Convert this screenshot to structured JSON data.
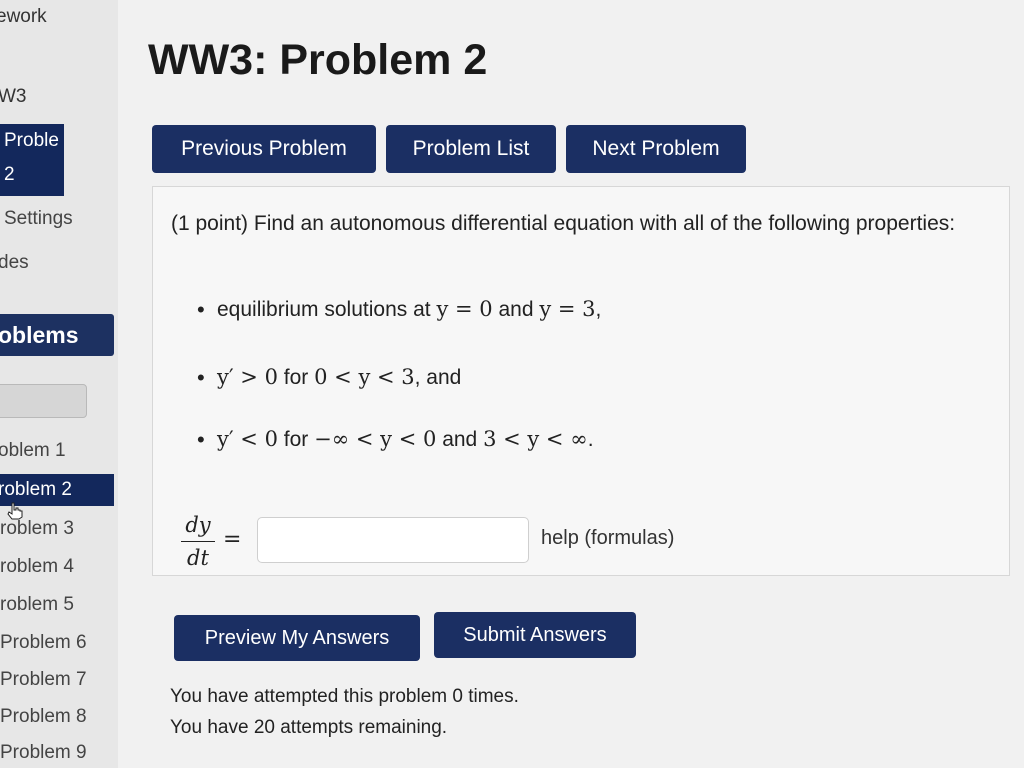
{
  "sidebar": {
    "course_fragment": "ework",
    "set_fragment": "W3",
    "current_problem": [
      "Proble",
      "2"
    ],
    "settings": "Settings",
    "grades_fragment": "des",
    "problems_header": "oblems",
    "problems": [
      "oblem 1",
      "roblem 2",
      "roblem 3",
      "roblem 4",
      "roblem 5",
      "Problem 6",
      "Problem 7",
      "Problem 8",
      "Problem 9"
    ],
    "active_index": 1
  },
  "header": {
    "title": "WW3: Problem 2"
  },
  "nav": {
    "previous": "Previous Problem",
    "list": "Problem List",
    "next": "Next Problem"
  },
  "problem": {
    "intro": "(1 point) Find an autonomous differential equation with all of the following properties:",
    "bullets": {
      "b1": {
        "p1": "equilibrium solutions at ",
        "m1": "y = 0",
        "p2": " and ",
        "m2": "y = 3",
        "p3": ","
      },
      "b2": {
        "m1": "y′ > 0",
        "p1": " for ",
        "m2": "0 < y < 3",
        "p2": ", and"
      },
      "b3": {
        "m1": "y′ < 0",
        "p1": " for ",
        "m2": "−∞ < y < 0",
        "p2": " and ",
        "m3": "3 < y < ∞",
        "p3": "."
      }
    },
    "lhs": {
      "num": "dy",
      "den": "dt",
      "eq": "="
    },
    "answer_value": "",
    "help": "help (formulas)"
  },
  "actions": {
    "preview": "Preview My Answers",
    "submit": "Submit Answers"
  },
  "attempts": {
    "line1": "You have attempted this problem 0 times.",
    "line2": "You have 20 attempts remaining."
  },
  "colors": {
    "button_bg": "#1b2f63",
    "active_bg": "#13285c"
  },
  "icons": {
    "cursor": "hand-pointer-icon"
  }
}
